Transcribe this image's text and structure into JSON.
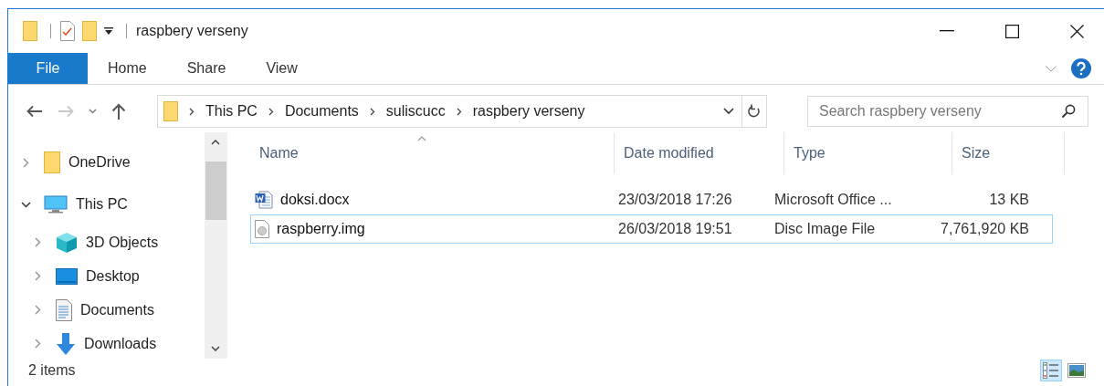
{
  "window": {
    "title": "raspbery verseny"
  },
  "ribbon_tabs": [
    {
      "label": "File",
      "selected": true
    },
    {
      "label": "Home",
      "selected": false
    },
    {
      "label": "Share",
      "selected": false
    },
    {
      "label": "View",
      "selected": false
    }
  ],
  "address_bar": {
    "segments": [
      "This PC",
      "Documents",
      "suliscucc",
      "raspbery verseny"
    ]
  },
  "search": {
    "placeholder": "Search raspbery verseny"
  },
  "sidebar": {
    "items": [
      {
        "label": "OneDrive",
        "kind": "folder",
        "expanded": false
      },
      {
        "label": "This PC",
        "kind": "pc",
        "expanded": true,
        "children": [
          {
            "label": "3D Objects",
            "kind": "cube",
            "expanded": false
          },
          {
            "label": "Desktop",
            "kind": "desktop",
            "expanded": false
          },
          {
            "label": "Documents",
            "kind": "documents",
            "expanded": false
          },
          {
            "label": "Downloads",
            "kind": "downloads",
            "expanded": false
          }
        ]
      }
    ]
  },
  "table": {
    "columns": [
      "Name",
      "Date modified",
      "Type",
      "Size"
    ],
    "rows": [
      {
        "kind": "word",
        "name": "doksi.docx",
        "date": "23/03/2018 17:26",
        "type": "Microsoft Office ...",
        "size": "13 KB",
        "selected": false
      },
      {
        "kind": "disc",
        "name": "raspberry.img",
        "date": "26/03/2018 19:51",
        "type": "Disc Image File",
        "size": "7,761,920 KB",
        "selected": true
      }
    ]
  },
  "status_bar": {
    "count": "2 items",
    "views": [
      {
        "kind": "details",
        "selected": true
      },
      {
        "kind": "thumbnails",
        "selected": false
      }
    ]
  }
}
